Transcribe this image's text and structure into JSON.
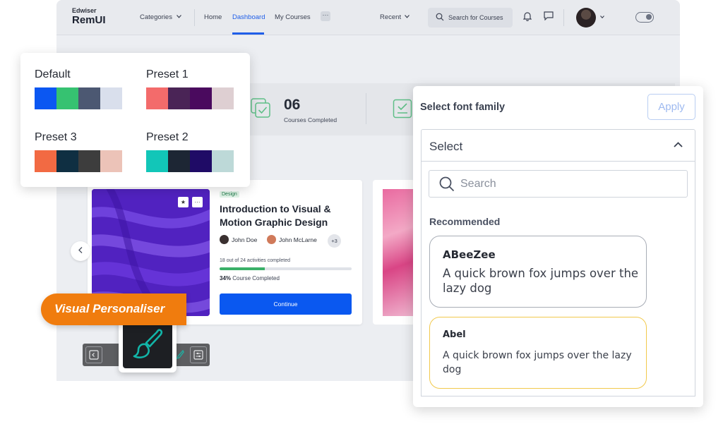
{
  "app": {
    "brand_small": "Edwiser",
    "brand_big": "RemUI",
    "nav": {
      "categories": "Categories",
      "home": "Home",
      "dashboard": "Dashboard",
      "my_courses": "My Courses",
      "more": "···",
      "recent": "Recent"
    },
    "search_label": "Search for Courses",
    "stats": {
      "count": "06",
      "label": "Courses Completed"
    },
    "course": {
      "tag": "Design",
      "title": "Introduction to Visual & Motion Graphic Design",
      "author1": "John Doe",
      "author2": "John McLarne",
      "more_authors": "+3",
      "activities": "18 out of 24 activities completed",
      "progress": 0.34,
      "percent": "34%",
      "completed_suffix": "Course Completed",
      "continue_label": "Continue"
    }
  },
  "presets": [
    {
      "name": "Default",
      "colors": [
        "#0b57f2",
        "#36c271",
        "#4c5872",
        "#d9dfec"
      ]
    },
    {
      "name": "Preset 1",
      "colors": [
        "#f36b6b",
        "#4a2456",
        "#4a0a5e",
        "#decfd2"
      ]
    },
    {
      "name": "Preset 3",
      "colors": [
        "#f26a43",
        "#0f2f42",
        "#3d3d3d",
        "#ecc3b8"
      ]
    },
    {
      "name": "Preset 2",
      "colors": [
        "#12c6b8",
        "#1d2634",
        "#1f0b66",
        "#bdd9d8"
      ]
    }
  ],
  "badge": {
    "label": "Visual Personaliser"
  },
  "font_panel": {
    "title": "Select font family",
    "apply_label": "Apply",
    "select_value": "Select",
    "search_placeholder": "Search",
    "recommended_label": "Recommended",
    "options": [
      {
        "name": "ABeeZee",
        "sample": "A quick brown fox jumps over the lazy dog"
      },
      {
        "name": "Abel",
        "sample": "A quick brown fox jumps over the lazy dog"
      }
    ]
  }
}
